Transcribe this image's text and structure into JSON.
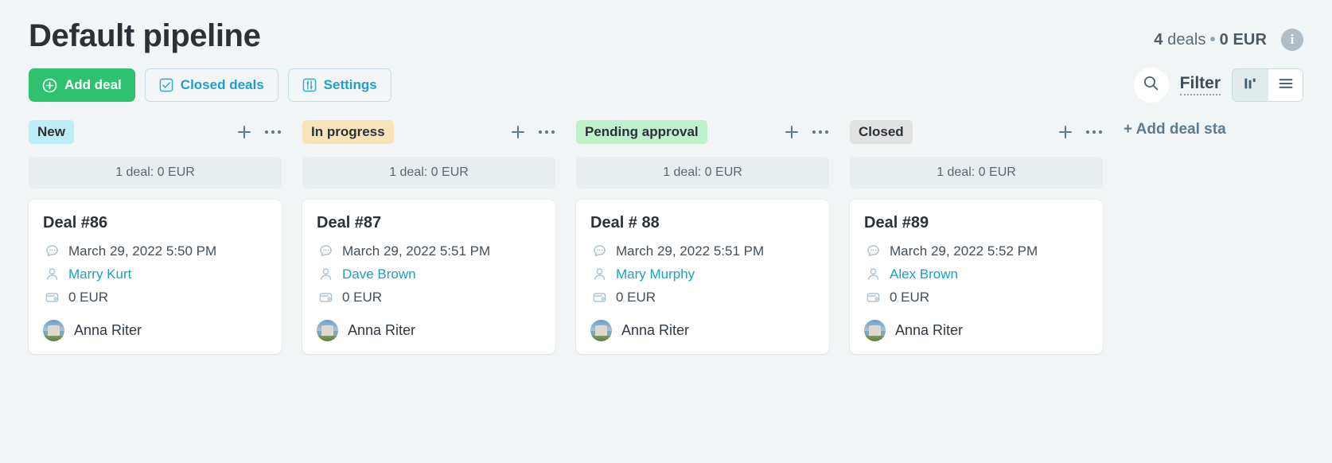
{
  "header": {
    "title": "Default pipeline",
    "summary": {
      "count": "4",
      "count_label": "deals",
      "separator": "•",
      "amount": "0 EUR"
    },
    "info_icon": "info-icon"
  },
  "toolbar": {
    "add_deal_label": "Add deal",
    "closed_deals_label": "Closed deals",
    "settings_label": "Settings",
    "filter_label": "Filter",
    "search_icon": "search-icon",
    "kanban_view_icon": "kanban-view-icon",
    "list_view_icon": "list-view-icon"
  },
  "board": {
    "add_stage_label": "+ Add deal sta",
    "columns": [
      {
        "stage": "New",
        "badge_color": "#bdeef5",
        "summary": "1 deal: 0 EUR",
        "card": {
          "title": "Deal #86",
          "date": "March 29, 2022 5:50 PM",
          "contact": "Marry Kurt",
          "amount": "0 EUR",
          "owner": "Anna Riter"
        }
      },
      {
        "stage": "In progress",
        "badge_color": "#f9e3b9",
        "summary": "1 deal: 0 EUR",
        "card": {
          "title": "Deal #87",
          "date": "March 29, 2022 5:51 PM",
          "contact": "Dave Brown",
          "amount": "0 EUR",
          "owner": "Anna Riter"
        }
      },
      {
        "stage": "Pending approval",
        "badge_color": "#bdf0cb",
        "summary": "1 deal: 0 EUR",
        "card": {
          "title": "Deal # 88",
          "date": "March 29, 2022 5:51 PM",
          "contact": "Mary Murphy",
          "amount": "0 EUR",
          "owner": "Anna Riter"
        }
      },
      {
        "stage": "Closed",
        "badge_color": "#e2e2e2",
        "summary": "1 deal: 0 EUR",
        "card": {
          "title": "Deal #89",
          "date": "March 29, 2022 5:52 PM",
          "contact": "Alex Brown",
          "amount": "0 EUR",
          "owner": "Anna Riter"
        }
      }
    ]
  }
}
